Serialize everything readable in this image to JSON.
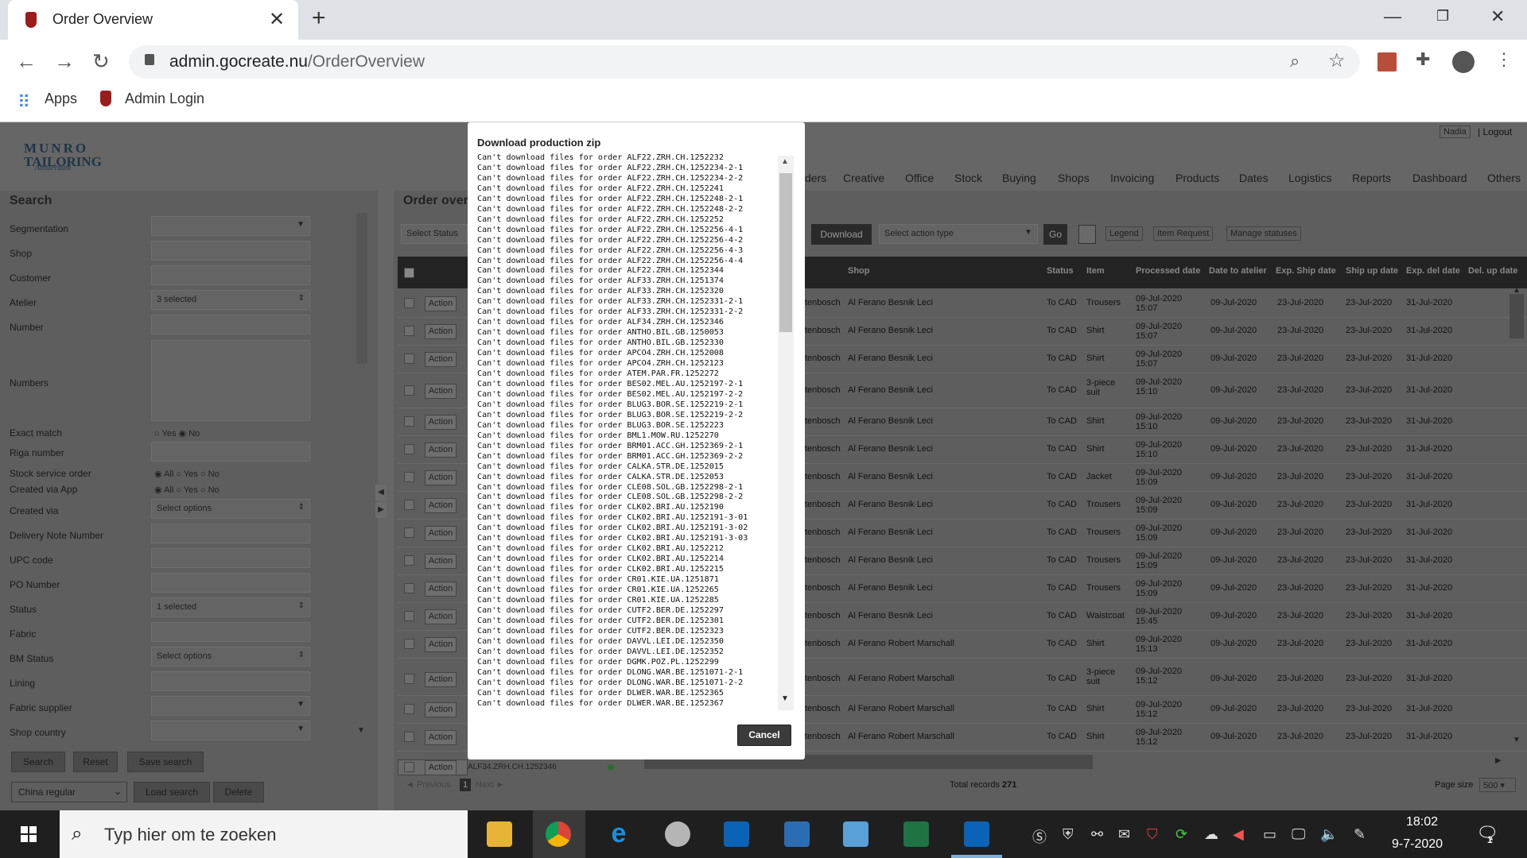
{
  "browser": {
    "tab_title": "Order Overview",
    "tab_close": "✕",
    "new_tab": "+",
    "url_domain": "admin.gocreate.nu",
    "url_path": "/OrderOverview",
    "bookmarks": [
      "Apps",
      "Admin Login"
    ]
  },
  "app": {
    "logo_line1": "MUNRO",
    "logo_line2": "TAILORING",
    "logo_sub": "Amsterdam",
    "user_name": "Nadia",
    "logout": "| Logout",
    "nav": [
      "ders",
      "Creative",
      "Office",
      "Stock",
      "Buying",
      "Shops",
      "Invoicing",
      "Products",
      "Dates",
      "Logistics",
      "Reports",
      "Dashboard",
      "Others"
    ]
  },
  "sidebar": {
    "title": "Search",
    "labels": [
      "Segmentation",
      "Shop",
      "Customer",
      "Atelier",
      "Number",
      "Numbers",
      "Exact match",
      "Riga number",
      "Stock service order",
      "Created via App",
      "Created via",
      "Delivery Note Number",
      "UPC code",
      "PO Number",
      "Status",
      "Fabric",
      "BM Status",
      "Lining",
      "Fabric supplier",
      "Shop country"
    ],
    "atelier_value": "3 selected",
    "created_via_value": "Select options",
    "status_value": "1 selected",
    "bm_status_value": "Select options",
    "exact_yes": "Yes",
    "exact_no": "No",
    "all": "All",
    "yes": "Yes",
    "no": "No",
    "buttons": {
      "search": "Search",
      "reset": "Reset",
      "save_search": "Save search",
      "load_search": "Load search",
      "delete": "Delete"
    },
    "saved_search": "China regular"
  },
  "main": {
    "title": "Order over",
    "select_status": "Select Status",
    "download": "Download",
    "select_action": "Select action type",
    "go": "Go",
    "legend": "Legend",
    "item_request": "Item Request",
    "manage_statuses": "Manage statuses",
    "columns": [
      "Shop",
      "Status",
      "Item",
      "Processed date",
      "Date to atelier",
      "Exp. Ship date",
      "Ship up date",
      "Exp. del date",
      "Del. up date"
    ],
    "rows": [
      {
        "shop_partial": "tenbosch",
        "shop": "Al Ferano Besnik Leci",
        "status": "To CAD",
        "item": "Trousers",
        "processed": "09-Jul-2020 15:07",
        "to_atelier": "09-Jul-2020",
        "exp_ship": "23-Jul-2020",
        "ship_up": "23-Jul-2020",
        "exp_del": "31-Jul-2020"
      },
      {
        "shop_partial": "tenbosch",
        "shop": "Al Ferano Besnik Leci",
        "status": "To CAD",
        "item": "Shirt",
        "processed": "09-Jul-2020 15:07",
        "to_atelier": "09-Jul-2020",
        "exp_ship": "23-Jul-2020",
        "ship_up": "23-Jul-2020",
        "exp_del": "31-Jul-2020"
      },
      {
        "shop_partial": "tenbosch",
        "shop": "Al Ferano Besnik Leci",
        "status": "To CAD",
        "item": "Shirt",
        "processed": "09-Jul-2020 15:07",
        "to_atelier": "09-Jul-2020",
        "exp_ship": "23-Jul-2020",
        "ship_up": "23-Jul-2020",
        "exp_del": "31-Jul-2020"
      },
      {
        "shop_partial": "tenbosch",
        "shop": "Al Ferano Besnik Leci",
        "status": "To CAD",
        "item": "3-piece suit",
        "processed": "09-Jul-2020 15:10",
        "to_atelier": "09-Jul-2020",
        "exp_ship": "23-Jul-2020",
        "ship_up": "23-Jul-2020",
        "exp_del": "31-Jul-2020"
      },
      {
        "shop_partial": "tenbosch",
        "shop": "Al Ferano Besnik Leci",
        "status": "To CAD",
        "item": "Shirt",
        "processed": "09-Jul-2020 15:10",
        "to_atelier": "09-Jul-2020",
        "exp_ship": "23-Jul-2020",
        "ship_up": "23-Jul-2020",
        "exp_del": "31-Jul-2020"
      },
      {
        "shop_partial": "tenbosch",
        "shop": "Al Ferano Besnik Leci",
        "status": "To CAD",
        "item": "Shirt",
        "processed": "09-Jul-2020 15:10",
        "to_atelier": "09-Jul-2020",
        "exp_ship": "23-Jul-2020",
        "ship_up": "23-Jul-2020",
        "exp_del": "31-Jul-2020"
      },
      {
        "shop_partial": "tenbosch",
        "shop": "Al Ferano Besnik Leci",
        "status": "To CAD",
        "item": "Jacket",
        "processed": "09-Jul-2020 15:09",
        "to_atelier": "09-Jul-2020",
        "exp_ship": "23-Jul-2020",
        "ship_up": "23-Jul-2020",
        "exp_del": "31-Jul-2020"
      },
      {
        "shop_partial": "tenbosch",
        "shop": "Al Ferano Besnik Leci",
        "status": "To CAD",
        "item": "Trousers",
        "processed": "09-Jul-2020 15:09",
        "to_atelier": "09-Jul-2020",
        "exp_ship": "23-Jul-2020",
        "ship_up": "23-Jul-2020",
        "exp_del": "31-Jul-2020"
      },
      {
        "shop_partial": "tenbosch",
        "shop": "Al Ferano Besnik Leci",
        "status": "To CAD",
        "item": "Trousers",
        "processed": "09-Jul-2020 15:09",
        "to_atelier": "09-Jul-2020",
        "exp_ship": "23-Jul-2020",
        "ship_up": "23-Jul-2020",
        "exp_del": "31-Jul-2020"
      },
      {
        "shop_partial": "tenbosch",
        "shop": "Al Ferano Besnik Leci",
        "status": "To CAD",
        "item": "Trousers",
        "processed": "09-Jul-2020 15:09",
        "to_atelier": "09-Jul-2020",
        "exp_ship": "23-Jul-2020",
        "ship_up": "23-Jul-2020",
        "exp_del": "31-Jul-2020"
      },
      {
        "shop_partial": "tenbosch",
        "shop": "Al Ferano Besnik Leci",
        "status": "To CAD",
        "item": "Trousers",
        "processed": "09-Jul-2020 15:09",
        "to_atelier": "09-Jul-2020",
        "exp_ship": "23-Jul-2020",
        "ship_up": "23-Jul-2020",
        "exp_del": "31-Jul-2020"
      },
      {
        "shop_partial": "tenbosch",
        "shop": "Al Ferano Besnik Leci",
        "status": "To CAD",
        "item": "Waistcoat",
        "processed": "09-Jul-2020 15:45",
        "to_atelier": "09-Jul-2020",
        "exp_ship": "23-Jul-2020",
        "ship_up": "23-Jul-2020",
        "exp_del": "31-Jul-2020"
      },
      {
        "shop_partial": "tenbosch",
        "shop": "Al Ferano Robert Marschall",
        "status": "To CAD",
        "item": "Shirt",
        "processed": "09-Jul-2020 15:13",
        "to_atelier": "09-Jul-2020",
        "exp_ship": "23-Jul-2020",
        "ship_up": "23-Jul-2020",
        "exp_del": "31-Jul-2020"
      },
      {
        "shop_partial": "tenbosch",
        "shop": "Al Ferano Robert Marschall",
        "status": "To CAD",
        "item": "3-piece suit",
        "processed": "09-Jul-2020 15:12",
        "to_atelier": "09-Jul-2020",
        "exp_ship": "23-Jul-2020",
        "ship_up": "23-Jul-2020",
        "exp_del": "31-Jul-2020"
      },
      {
        "shop_partial": "tenbosch",
        "shop": "Al Ferano Robert Marschall",
        "status": "To CAD",
        "item": "Shirt",
        "processed": "09-Jul-2020 15:12",
        "to_atelier": "09-Jul-2020",
        "exp_ship": "23-Jul-2020",
        "ship_up": "23-Jul-2020",
        "exp_del": "31-Jul-2020"
      },
      {
        "shop_partial": "tenbosch",
        "shop": "Al Ferano Robert Marschall",
        "status": "To CAD",
        "item": "Shirt",
        "processed": "09-Jul-2020 15:12",
        "to_atelier": "09-Jul-2020",
        "exp_ship": "23-Jul-2020",
        "ship_up": "23-Jul-2020",
        "exp_del": "31-Jul-2020"
      }
    ],
    "action_label": "Action",
    "partial_number": "ALF34.ZRH.CH.1252346",
    "previous": "◄ Previous",
    "page": "1",
    "next": "Next ►",
    "total_records_label": "Total records",
    "total_records": "271",
    "page_size_label": "Page size",
    "page_size": "500"
  },
  "modal": {
    "title": "Download production zip",
    "lines": [
      "Can't download files for order ALF22.ZRH.CH.1252232",
      "Can't download files for order ALF22.ZRH.CH.1252234-2-1",
      "Can't download files for order ALF22.ZRH.CH.1252234-2-2",
      "Can't download files for order ALF22.ZRH.CH.1252241",
      "Can't download files for order ALF22.ZRH.CH.1252248-2-1",
      "Can't download files for order ALF22.ZRH.CH.1252248-2-2",
      "Can't download files for order ALF22.ZRH.CH.1252252",
      "Can't download files for order ALF22.ZRH.CH.1252256-4-1",
      "Can't download files for order ALF22.ZRH.CH.1252256-4-2",
      "Can't download files for order ALF22.ZRH.CH.1252256-4-3",
      "Can't download files for order ALF22.ZRH.CH.1252256-4-4",
      "Can't download files for order ALF22.ZRH.CH.1252344",
      "Can't download files for order ALF33.ZRH.CH.1251374",
      "Can't download files for order ALF33.ZRH.CH.1252320",
      "Can't download files for order ALF33.ZRH.CH.1252331-2-1",
      "Can't download files for order ALF33.ZRH.CH.1252331-2-2",
      "Can't download files for order ALF34.ZRH.CH.1252346",
      "Can't download files for order ANTHO.BIL.GB.1250053",
      "Can't download files for order ANTHO.BIL.GB.1252330",
      "Can't download files for order APCO4.ZRH.CH.1252008",
      "Can't download files for order APCO4.ZRH.CH.1252123",
      "Can't download files for order ATEM.PAR.FR.1252272",
      "Can't download files for order BES02.MEL.AU.1252197-2-1",
      "Can't download files for order BES02.MEL.AU.1252197-2-2",
      "Can't download files for order BLUG3.BOR.SE.1252219-2-1",
      "Can't download files for order BLUG3.BOR.SE.1252219-2-2",
      "Can't download files for order BLUG3.BOR.SE.1252223",
      "Can't download files for order BML1.MOW.RU.1252270",
      "Can't download files for order BRM01.ACC.GH.1252369-2-1",
      "Can't download files for order BRM01.ACC.GH.1252369-2-2",
      "Can't download files for order CALKA.STR.DE.1252015",
      "Can't download files for order CALKA.STR.DE.1252053",
      "Can't download files for order CLE08.SOL.GB.1252298-2-1",
      "Can't download files for order CLE08.SOL.GB.1252298-2-2",
      "Can't download files for order CLK02.BRI.AU.1252190",
      "Can't download files for order CLK02.BRI.AU.1252191-3-01",
      "Can't download files for order CLK02.BRI.AU.1252191-3-02",
      "Can't download files for order CLK02.BRI.AU.1252191-3-03",
      "Can't download files for order CLK02.BRI.AU.1252212",
      "Can't download files for order CLK02.BRI.AU.1252214",
      "Can't download files for order CLK02.BRI.AU.1252215",
      "Can't download files for order CR01.KIE.UA.1251871",
      "Can't download files for order CR01.KIE.UA.1252265",
      "Can't download files for order CR01.KIE.UA.1252285",
      "Can't download files for order CUTF2.BER.DE.1252297",
      "Can't download files for order CUTF2.BER.DE.1252301",
      "Can't download files for order CUTF2.BER.DE.1252323",
      "Can't download files for order DAVVL.LEI.DE.1252350",
      "Can't download files for order DAVVL.LEI.DE.1252352",
      "Can't download files for order DGMK.POZ.PL.1252299",
      "Can't download files for order DLONG.WAR.BE.1251071-2-1",
      "Can't download files for order DLONG.WAR.BE.1251071-2-2",
      "Can't download files for order DLWER.WAR.BE.1252365",
      "Can't download files for order DLWER.WAR.BE.1252367"
    ],
    "cancel": "Cancel"
  },
  "taskbar": {
    "search_placeholder": "Typ hier om te zoeken",
    "time": "18:02",
    "date": "9-7-2020",
    "notification_count": "1"
  }
}
